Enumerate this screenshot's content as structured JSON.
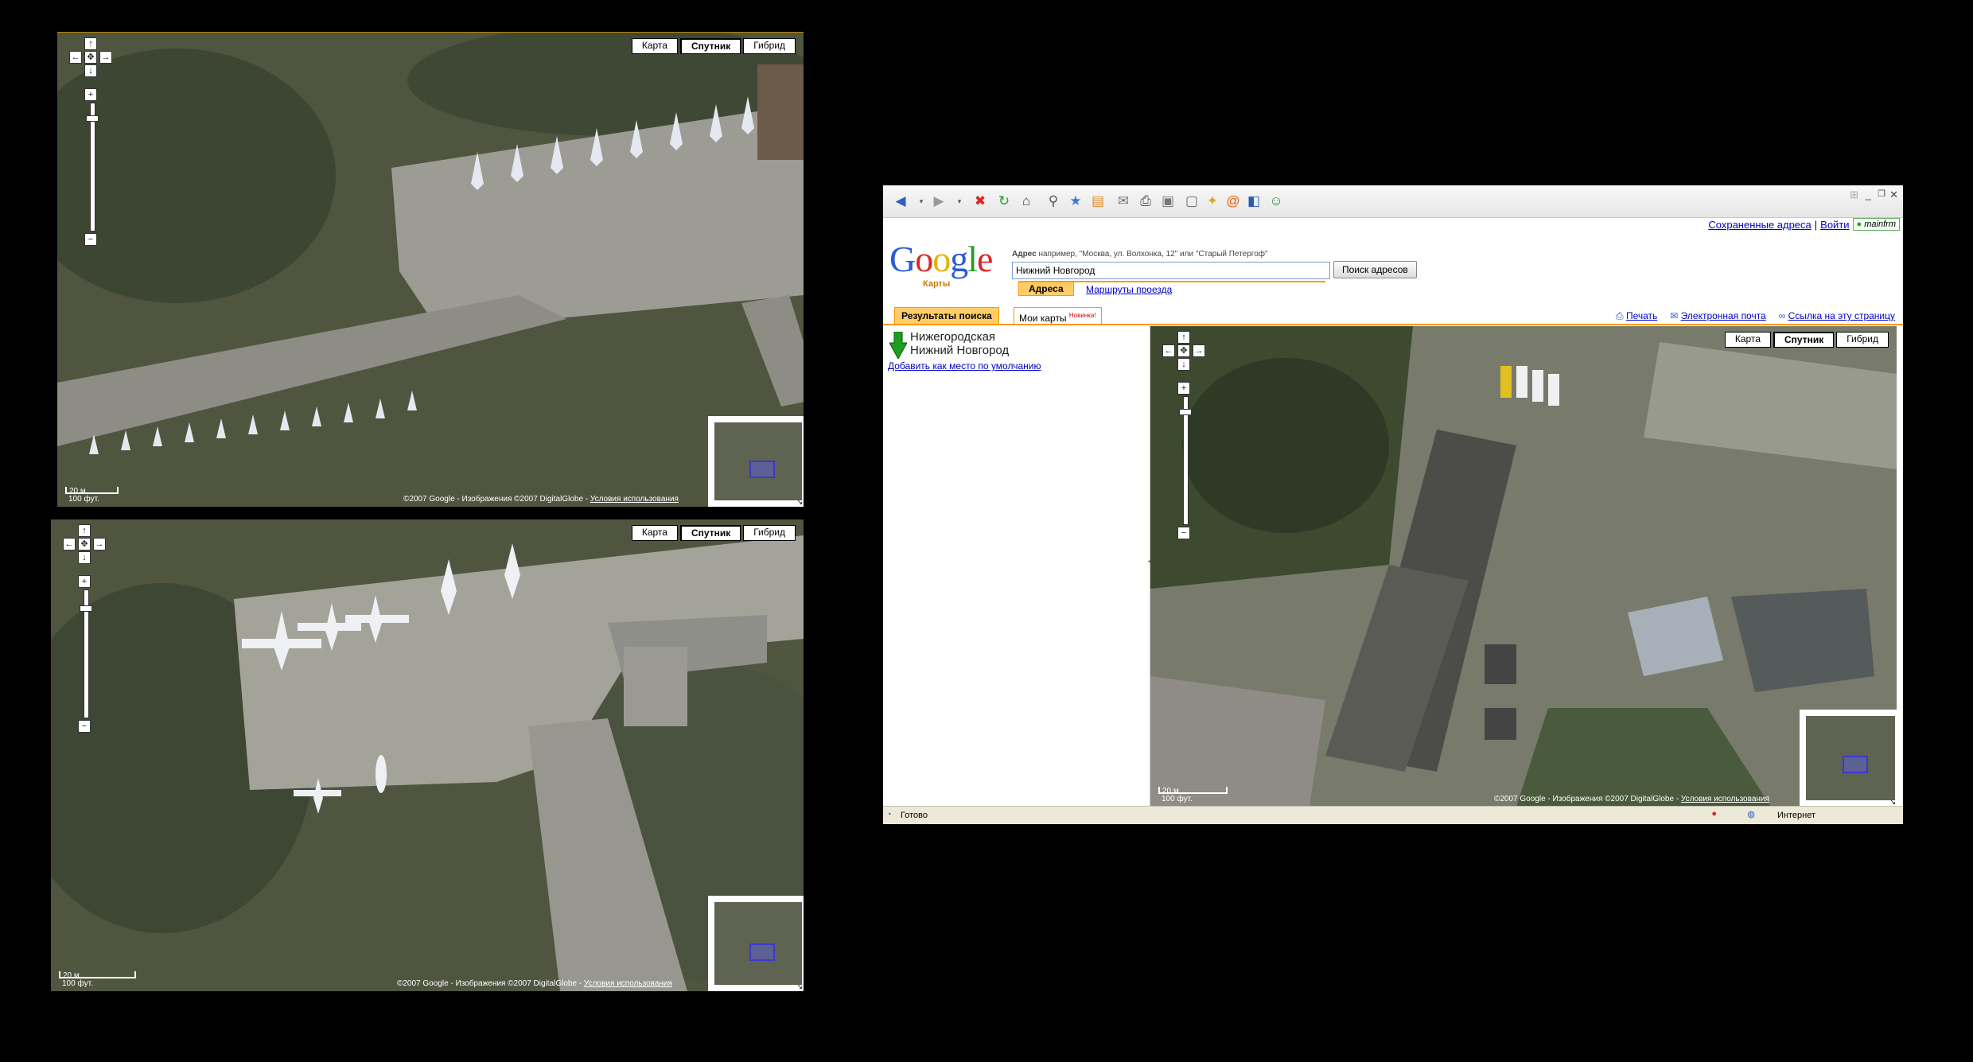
{
  "map_types": {
    "map": "Карта",
    "satellite": "Спутник",
    "hybrid": "Гибрид"
  },
  "scale": {
    "metric": "20 м",
    "imperial": "100 фут."
  },
  "copyright": {
    "text": "©2007 Google - Изображения ©2007 DigitalGlobe -",
    "terms": "Условия использования"
  },
  "browser": {
    "top_links": {
      "saved": "Сохраненные адреса",
      "separator": "|",
      "login": "Войти",
      "badge": "mainfrm"
    },
    "logo": {
      "text": "Google",
      "sub": "Карты"
    },
    "search": {
      "label": "Адрес",
      "hint": "например, \"Москва, ул. Волхонка, 12\" или \"Старый Петергоф\"",
      "value": "Нижний Новгород",
      "button": "Поиск адресов"
    },
    "subtabs": {
      "addresses": "Адреса",
      "directions": "Маршруты проезда"
    },
    "panel_tabs": {
      "results": "Результаты поиска",
      "mymaps": "Мои карты",
      "new_badge": "Новинка!"
    },
    "actions": {
      "print": "Печать",
      "email": "Электронная почта",
      "link": "Ссылка на эту страницу"
    },
    "result": {
      "line1": "Нижегородская",
      "line2": "Нижний Новгород",
      "set_default": "Добавить как место по умолчанию"
    },
    "status": {
      "text": "Готово",
      "zone": "Интернет"
    }
  },
  "colors": {
    "accent": "#ff9900",
    "link": "#0000cc",
    "tab_active_bg": "#ffcc66"
  }
}
